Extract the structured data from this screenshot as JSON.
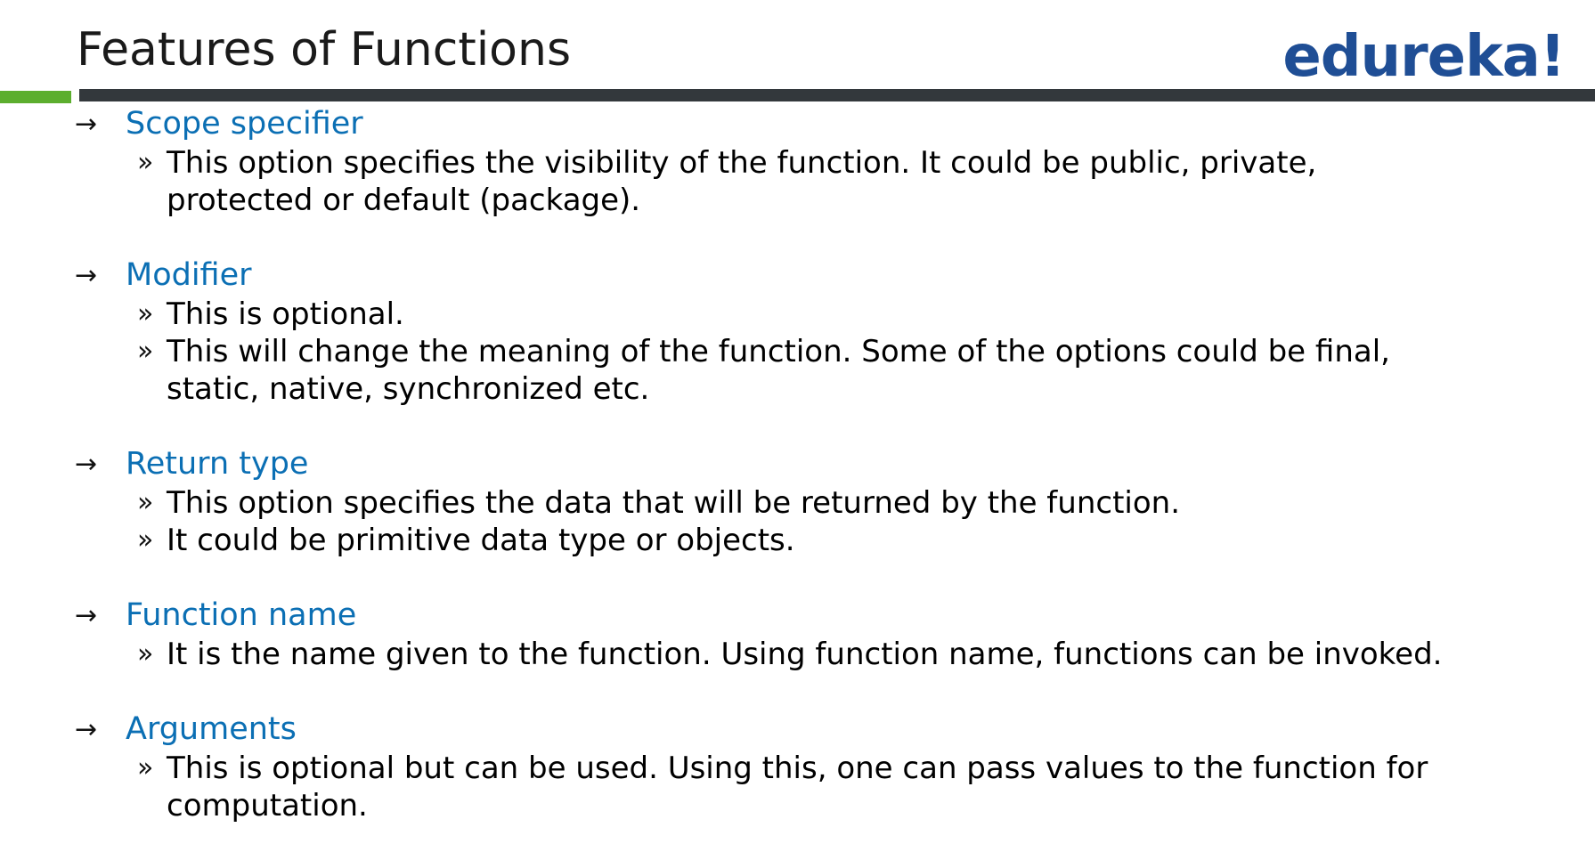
{
  "slide": {
    "title": "Features of Functions",
    "logo": "edureka!",
    "colors": {
      "heading": "#0b6fb4",
      "logo": "#1f4e95",
      "green_bar": "#5cae2e",
      "dark_bar": "#33383c"
    },
    "arrow_symbol": "→",
    "bullet_symbol": "»",
    "sections": [
      {
        "heading": "Scope specifier",
        "bullets": [
          "This option specifies the visibility of the function. It could be public, private, protected or default (package)."
        ]
      },
      {
        "heading": "Modifier",
        "bullets": [
          "This is optional.",
          "This will change the meaning of the function. Some of the options could be final, static, native, synchronized etc."
        ]
      },
      {
        "heading": "Return type",
        "bullets": [
          "This option specifies the data that will be returned by the function.",
          "It could be primitive data type or objects."
        ]
      },
      {
        "heading": "Function name",
        "bullets": [
          "It is the name given to the function. Using function name, functions can be invoked."
        ]
      },
      {
        "heading": "Arguments",
        "bullets": [
          "This is optional but can be used. Using this, one can pass values to the function for computation."
        ]
      }
    ]
  }
}
